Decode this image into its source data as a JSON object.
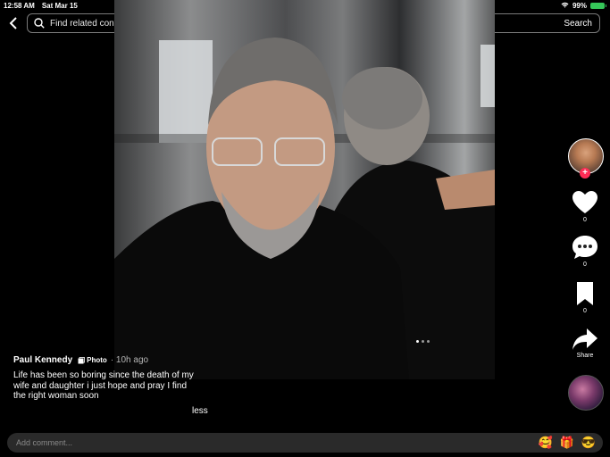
{
  "status": {
    "time": "12:58 AM",
    "date": "Sat Mar 15",
    "battery": "99%"
  },
  "search": {
    "placeholder": "Find related content",
    "button": "Search"
  },
  "post": {
    "author": "Paul Kennedy",
    "type_badge": "Photo",
    "time": "· 10h ago",
    "caption": "Life has been so boring since the death of my wife and daughter i just hope and pray I find the right woman soon",
    "less_label": "less"
  },
  "actions": {
    "likes": "0",
    "comments": "0",
    "saves": "0",
    "share_label": "Share"
  },
  "comment": {
    "placeholder": "Add comment...",
    "emojis": [
      "🥰",
      "🎁",
      "😎"
    ]
  },
  "carousel": {
    "total": 3,
    "active": 1
  },
  "colors": {
    "follow_accent": "#fe2c55",
    "battery": "#35c759"
  }
}
